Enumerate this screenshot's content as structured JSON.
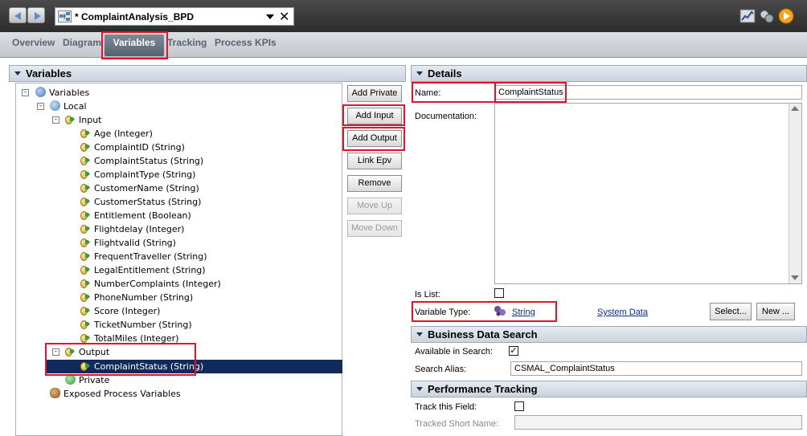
{
  "window": {
    "process_title": "* ComplaintAnalysis_BPD"
  },
  "tabs": [
    {
      "label": "Overview"
    },
    {
      "label": "Diagram"
    },
    {
      "label": "Variables"
    },
    {
      "label": "Tracking"
    },
    {
      "label": "Process KPIs"
    }
  ],
  "variables_panel": {
    "title": "Variables",
    "tree": {
      "root": "Variables",
      "local": "Local",
      "input": "Input",
      "inputs": [
        "Age (Integer)",
        "ComplaintID (String)",
        "ComplaintStatus (String)",
        "ComplaintType (String)",
        "CustomerName (String)",
        "CustomerStatus (String)",
        "Entitlement (Boolean)",
        "Flightdelay (Integer)",
        "Flightvalid (String)",
        "FrequentTraveller (String)",
        "LegalEntitlement (String)",
        "NumberComplaints (Integer)",
        "PhoneNumber (String)",
        "Score (Integer)",
        "TicketNumber (String)",
        "TotalMiles (Integer)"
      ],
      "output": "Output",
      "outputs": [
        "ComplaintStatus (String)"
      ],
      "private": "Private",
      "exposed": "Exposed Process Variables"
    },
    "buttons": {
      "add_private": "Add Private",
      "add_input": "Add Input",
      "add_output": "Add Output",
      "link_epv": "Link Epv",
      "remove": "Remove",
      "move_up": "Move Up",
      "move_down": "Move Down"
    }
  },
  "details": {
    "title": "Details",
    "name_label": "Name:",
    "name_value": "ComplaintStatus",
    "documentation_label": "Documentation:",
    "is_list_label": "Is List:",
    "variable_type_label": "Variable Type:",
    "variable_type_value": "String",
    "system_data_link": "System Data",
    "select_button": "Select...",
    "new_button": "New ..."
  },
  "business_data_search": {
    "title": "Business Data Search",
    "available_label": "Available in Search:",
    "alias_label": "Search Alias:",
    "alias_value": "CSMAL_ComplaintStatus"
  },
  "performance_tracking": {
    "title": "Performance Tracking",
    "track_label": "Track this Field:",
    "short_name_label": "Tracked Short Name:"
  },
  "colors": {
    "highlight_red": "#e0142a",
    "selection_blue": "#112a5c",
    "link_blue": "#0b2f88"
  }
}
